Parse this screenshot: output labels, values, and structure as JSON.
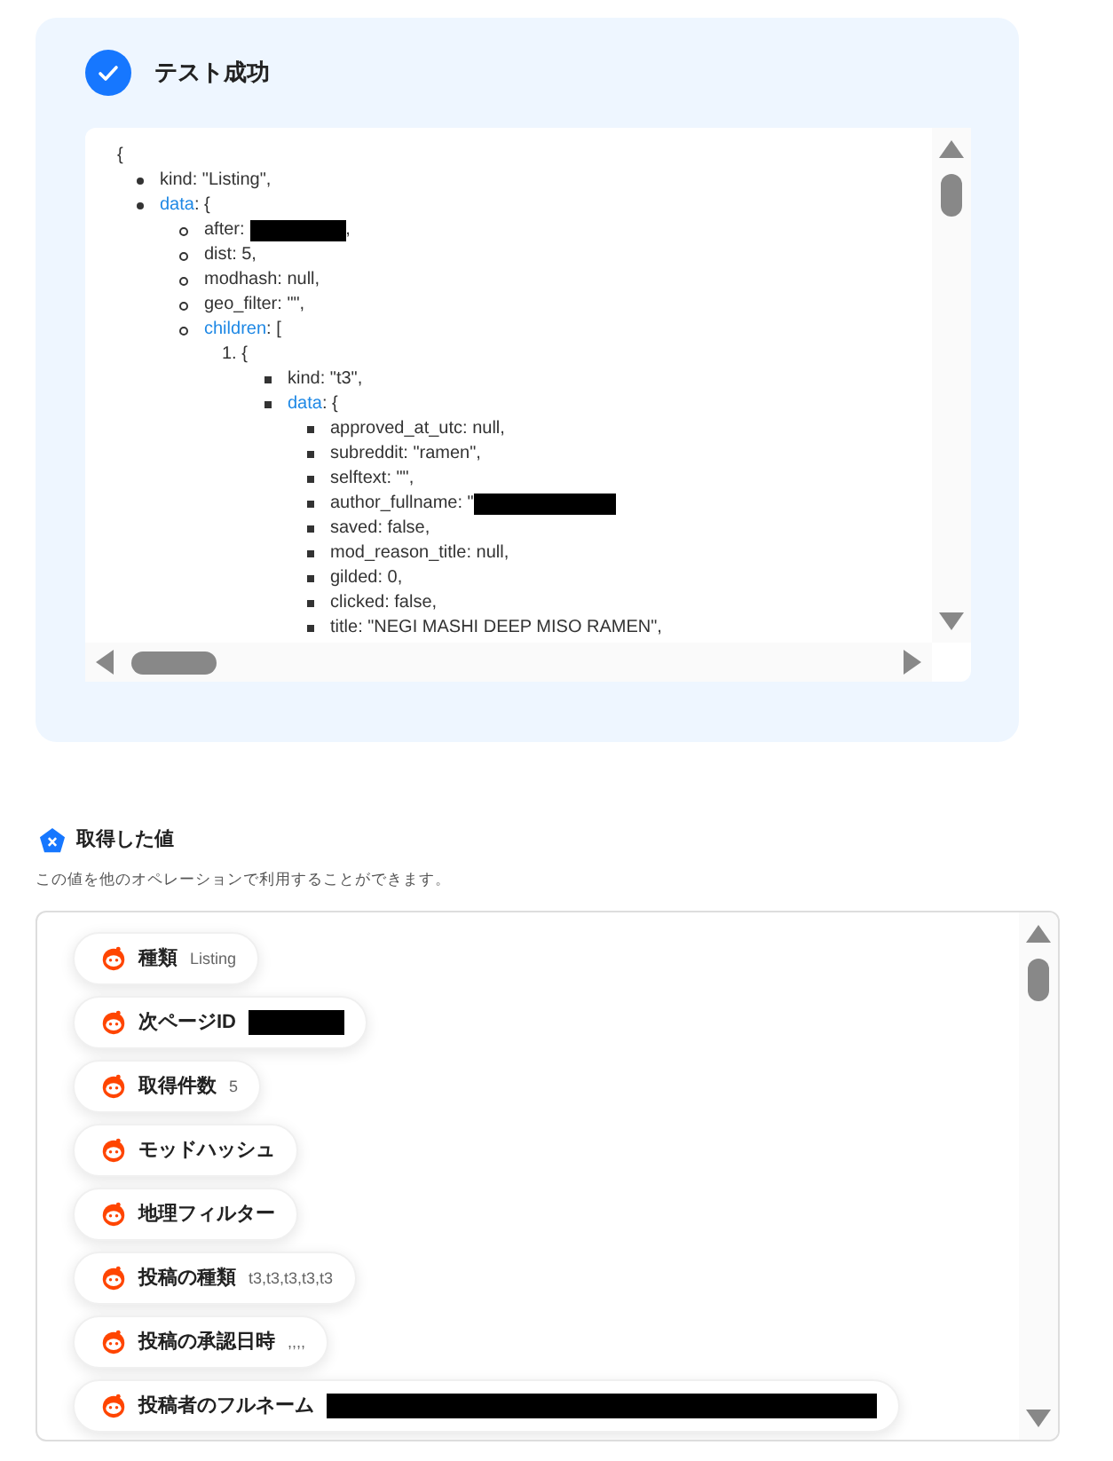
{
  "result": {
    "title": "テスト成功",
    "success": true
  },
  "json_view": {
    "open": "{",
    "items": [
      {
        "kind": "pair",
        "key": "kind",
        "link": false,
        "rest": ": \"Listing\","
      },
      {
        "kind": "pair",
        "key": "data",
        "link": true,
        "rest": ": {",
        "children": [
          {
            "kind": "pair",
            "key": "after",
            "link": false,
            "rest": ": ",
            "redacted": true,
            "tail": ","
          },
          {
            "kind": "pair",
            "key": "dist",
            "link": false,
            "rest": ": 5,"
          },
          {
            "kind": "pair",
            "key": "modhash",
            "link": false,
            "rest": ": null,"
          },
          {
            "kind": "pair",
            "key": "geo_filter",
            "link": false,
            "rest": ": \"\","
          },
          {
            "kind": "pair",
            "key": "children",
            "link": true,
            "rest": ": [",
            "children": [
              {
                "kind": "numbered",
                "marker": "1.",
                "rest": "{",
                "children": [
                  {
                    "kind": "pair",
                    "key": "kind",
                    "link": false,
                    "rest": ": \"t3\","
                  },
                  {
                    "kind": "pair",
                    "key": "data",
                    "link": true,
                    "rest": ": {",
                    "children": [
                      {
                        "kind": "pair",
                        "key": "approved_at_utc",
                        "link": false,
                        "rest": ": null,"
                      },
                      {
                        "kind": "pair",
                        "key": "subreddit",
                        "link": false,
                        "rest": ": \"ramen\","
                      },
                      {
                        "kind": "pair",
                        "key": "selftext",
                        "link": false,
                        "rest": ": \"\","
                      },
                      {
                        "kind": "pair",
                        "key": "author_fullname",
                        "link": false,
                        "rest": ": \"",
                        "redacted": true
                      },
                      {
                        "kind": "pair",
                        "key": "saved",
                        "link": false,
                        "rest": ": false,"
                      },
                      {
                        "kind": "pair",
                        "key": "mod_reason_title",
                        "link": false,
                        "rest": ": null,"
                      },
                      {
                        "kind": "pair",
                        "key": "gilded",
                        "link": false,
                        "rest": ": 0,"
                      },
                      {
                        "kind": "pair",
                        "key": "clicked",
                        "link": false,
                        "rest": ": false,"
                      },
                      {
                        "kind": "pair",
                        "key": "title",
                        "link": false,
                        "rest": ": \"NEGI MASHI DEEP MISO RAMEN\","
                      }
                    ]
                  }
                ]
              }
            ]
          }
        ]
      }
    ]
  },
  "values": {
    "title": "取得した値",
    "description": "この値を他のオペレーションで利用することができます。",
    "items": [
      {
        "label": "種類",
        "value": "Listing"
      },
      {
        "label": "次ページID",
        "redacted": true
      },
      {
        "label": "取得件数",
        "value": "5"
      },
      {
        "label": "モッドハッシュ"
      },
      {
        "label": "地理フィルター"
      },
      {
        "label": "投稿の種類",
        "value": "t3,t3,t3,t3,t3"
      },
      {
        "label": "投稿の承認日時",
        "value": ",,,,"
      },
      {
        "label": "投稿者のフルネーム",
        "redacted": true
      }
    ]
  }
}
